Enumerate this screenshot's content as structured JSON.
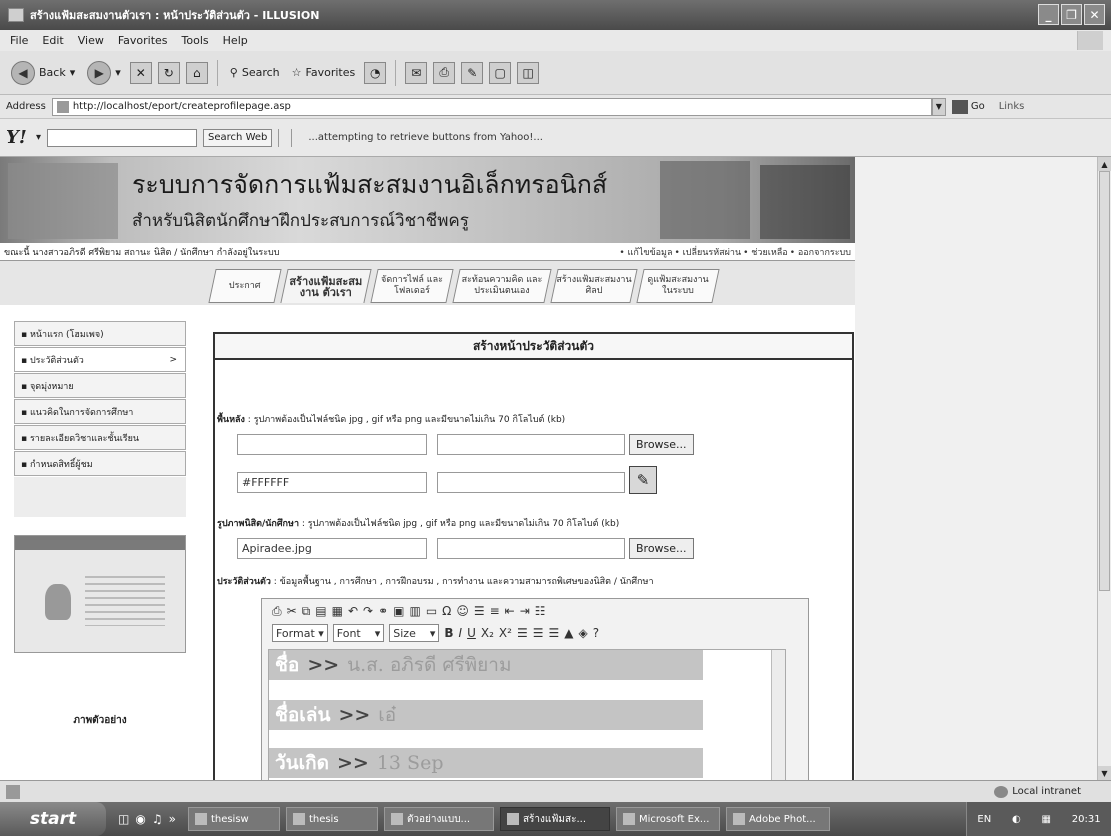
{
  "window": {
    "title": "สร้างแฟ้มสะสมงานตัวเรา : หน้าประวัติส่วนตัว - ILLUSION",
    "controls": [
      "_",
      "❐",
      "✕"
    ]
  },
  "menu": [
    "File",
    "Edit",
    "View",
    "Favorites",
    "Tools",
    "Help"
  ],
  "toolbar": {
    "back": "Back",
    "search": "Search",
    "favorites": "Favorites"
  },
  "address": {
    "label": "Address",
    "url": "http://localhost/eport/createprofilepage.asp",
    "go": "Go",
    "links": "Links"
  },
  "yahoo": {
    "logo": "Y!",
    "search_button": "Search Web",
    "message": "...attempting to retrieve buttons from Yahoo!..."
  },
  "site": {
    "title": "ระบบการจัดการแฟ้มสะสมงานอิเล็กทรอนิกส์",
    "subtitle": "สำหรับนิสิตนักศึกษาฝึกประสบการณ์วิชาชีพครู",
    "user_status": "ขณะนี้ นางสาวอภิรดี ศรีพิยาม สถานะ นิสิต / นักศึกษา กำลังอยู่ในระบบ",
    "top_links": [
      "• แก้ไขข้อมูล",
      "• เปลี่ยนรหัสผ่าน",
      "• ช่วยเหลือ",
      "• ออกจากระบบ"
    ]
  },
  "tabs": [
    {
      "label": "ประกาศ"
    },
    {
      "label": "สร้างแฟ้มสะสมงาน ตัวเรา"
    },
    {
      "label": "จัดการไฟล์ และโฟลเดอร์"
    },
    {
      "label": "สะท้อนความคิด และประเมินตนเอง"
    },
    {
      "label": "สร้างแฟ้มสะสมงาน ศิลป"
    },
    {
      "label": "ดูแฟ้มสะสมงาน ในระบบ"
    }
  ],
  "left_menu": [
    {
      "label": "▪ หน้าแรก (โฮมเพจ)"
    },
    {
      "label": "▪ ประวัติส่วนตัว",
      "arrow": ">"
    },
    {
      "label": "▪ จุดมุ่งหมาย"
    },
    {
      "label": "▪ แนวคิดในการจัดการศึกษา"
    },
    {
      "label": "▪ รายละเอียดวิชาและชั้นเรียน"
    },
    {
      "label": "▪ กำหนดสิทธิ์ผู้ชม"
    }
  ],
  "thumbnail_caption": "ภาพตัวอย่าง",
  "form": {
    "heading": "สร้างหน้าประวัติส่วนตัว",
    "bg_label_bold": "พื้นหลัง",
    "bg_label_rest": " : รูปภาพต้องเป็นไฟล์ชนิด jpg , gif หรือ png และมีขนาดไม่เกิน 70 กิโลไบต์ (kb)",
    "browse": "Browse...",
    "color_value": "#FFFFFF",
    "photo_label_bold": "รูปภาพนิสิต/นักศึกษา",
    "photo_label_rest": " : รูปภาพต้องเป็นไฟล์ชนิด jpg , gif หรือ png และมีขนาดไม่เกิน 70 กิโลไบต์ (kb)",
    "photo_value": "Apiradee.jpg",
    "profile_label_bold": "ประวัติส่วนตัว",
    "profile_label_rest": " : ข้อมูลพื้นฐาน , การศึกษา , การฝึกอบรม , การทำงาน และความสามารถพิเศษของนิสิต / นักศึกษา"
  },
  "editor": {
    "format": "Format",
    "font": "Font",
    "size": "Size",
    "rows": [
      {
        "key": "ชื่อ",
        "arrow": ">>",
        "value": "น.ส. อภิรดี   ศรีพิยาม"
      },
      {
        "key": "ชื่อเล่น",
        "arrow": ">>",
        "value": "เอ๋"
      },
      {
        "key": "วันเกิด",
        "arrow": ">>",
        "value": "13 Sep"
      }
    ]
  },
  "status": {
    "zone": "Local intranet"
  },
  "taskbar": {
    "start": "start",
    "tasks": [
      {
        "label": "thesisw"
      },
      {
        "label": "thesis"
      },
      {
        "label": "ตัวอย่างแบบ..."
      },
      {
        "label": "สร้างแฟ้มสะ...",
        "active": true
      },
      {
        "label": "Microsoft Ex..."
      },
      {
        "label": "Adobe Phot..."
      }
    ],
    "lang": "EN",
    "clock": "20:31"
  }
}
